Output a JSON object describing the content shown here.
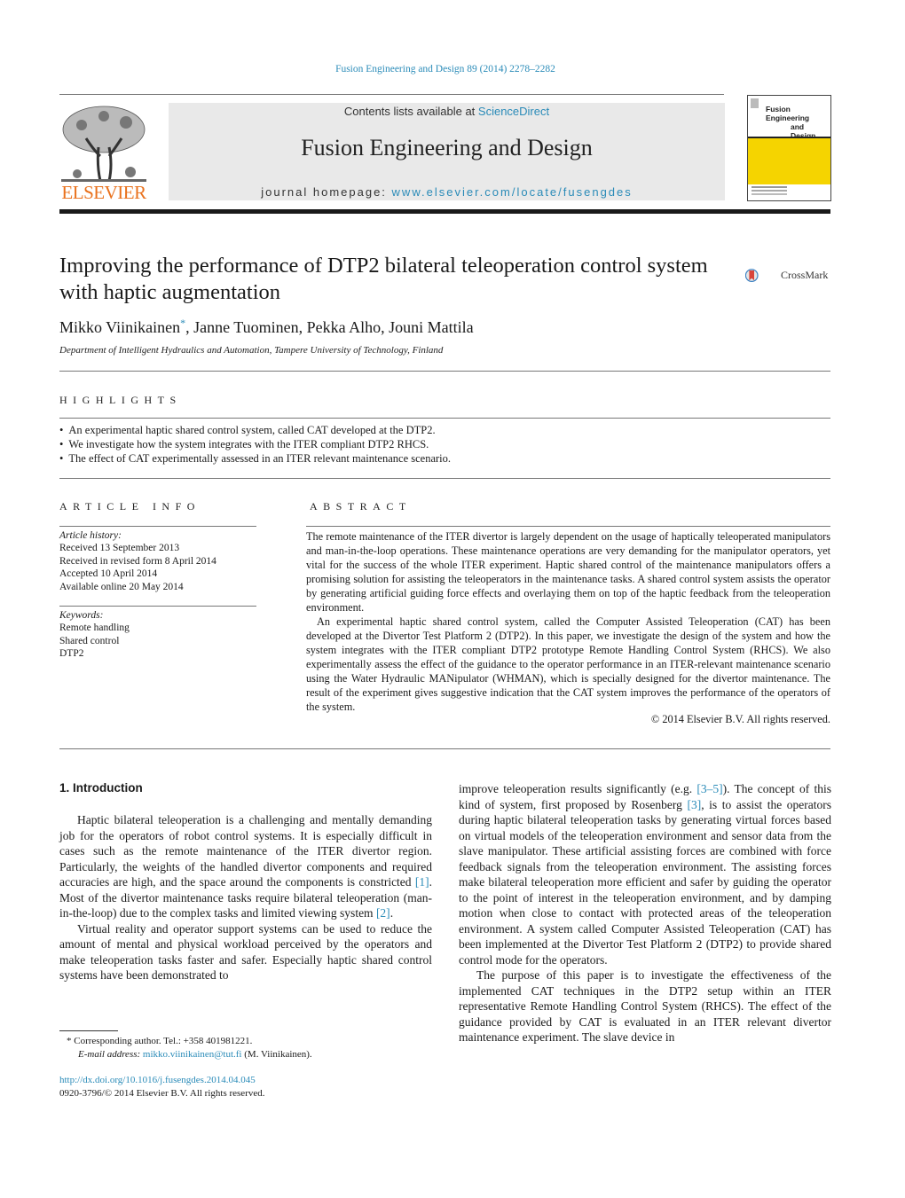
{
  "header": {
    "journal_reference": "Fusion Engineering and Design 89 (2014) 2278–2282",
    "publisher_logo_text": "ELSEVIER",
    "contents_prefix": "Contents lists available at ",
    "contents_link": "ScienceDirect",
    "journal_name": "Fusion Engineering and Design",
    "homepage_prefix": "journal homepage: ",
    "homepage_link": "www.elsevier.com/locate/fusengdes",
    "cover_title_line1": "Fusion Engineering",
    "cover_title_line2": "and Design",
    "cover_yellow": "#f5d400",
    "brand_orange": "#e9711c",
    "link_color": "#2a8bb8"
  },
  "article": {
    "title": "Improving the performance of DTP2 bilateral teleoperation control system with haptic augmentation",
    "crossmark_label": "CrossMark",
    "authors": [
      {
        "name": "Mikko Viinikainen",
        "mark": "*"
      },
      {
        "name": "Janne Tuominen"
      },
      {
        "name": "Pekka Alho"
      },
      {
        "name": "Jouni Mattila"
      }
    ],
    "author_separator": ", ",
    "affiliation": "Department of Intelligent Hydraulics and Automation, Tampere University of Technology, Finland"
  },
  "highlights": {
    "heading": "HIGHLIGHTS",
    "items": [
      "An experimental haptic shared control system, called CAT developed at the DTP2.",
      "We investigate how the system integrates with the ITER compliant DTP2 RHCS.",
      "The effect of CAT experimentally assessed in an ITER relevant maintenance scenario."
    ]
  },
  "article_info": {
    "heading": "ARTICLE INFO",
    "history_label": "Article history:",
    "history": [
      "Received 13 September 2013",
      "Received in revised form 8 April 2014",
      "Accepted 10 April 2014",
      "Available online 20 May 2014"
    ],
    "keywords_label": "Keywords:",
    "keywords": [
      "Remote handling",
      "Shared control",
      "DTP2"
    ]
  },
  "abstract": {
    "heading": "ABSTRACT",
    "paragraphs": [
      "The remote maintenance of the ITER divertor is largely dependent on the usage of haptically teleoperated manipulators and man-in-the-loop operations. These maintenance operations are very demanding for the manipulator operators, yet vital for the success of the whole ITER experiment. Haptic shared control of the maintenance manipulators offers a promising solution for assisting the teleoperators in the maintenance tasks. A shared control system assists the operator by generating artificial guiding force effects and overlaying them on top of the haptic feedback from the teleoperation environment.",
      "An experimental haptic shared control system, called the Computer Assisted Teleoperation (CAT) has been developed at the Divertor Test Platform 2 (DTP2). In this paper, we investigate the design of the system and how the system integrates with the ITER compliant DTP2 prototype Remote Handling Control System (RHCS). We also experimentally assess the effect of the guidance to the operator performance in an ITER-relevant maintenance scenario using the Water Hydraulic MANipulator (WHMAN), which is specially designed for the divertor maintenance. The result of the experiment gives suggestive indication that the CAT system improves the performance of the operators of the system."
    ],
    "copyright": "© 2014  Elsevier B.V. All rights reserved."
  },
  "body": {
    "section_heading": "1.  Introduction",
    "left": {
      "p1_a": "Haptic bilateral teleoperation is a challenging and mentally demanding job for the operators of robot control systems. It is especially difficult in cases such as the remote maintenance of the ITER divertor region. Particularly, the weights of the handled divertor components and required accuracies are high, and the space around the components is constricted ",
      "p1_ref1": "[1]",
      "p1_b": ". Most of the divertor maintenance tasks require bilateral teleoperation (man-in-the-loop) due to the complex tasks and limited viewing system ",
      "p1_ref2": "[2]",
      "p1_c": ".",
      "p2": "Virtual reality and operator support systems can be used to reduce the amount of mental and physical workload perceived by the operators and make teleoperation tasks faster and safer. Especially haptic shared control systems have been demonstrated to"
    },
    "right": {
      "p1_a": "improve teleoperation results significantly (e.g. ",
      "p1_ref1": "[3–5]",
      "p1_b": "). The concept of this kind of system, first proposed by Rosenberg ",
      "p1_ref2": "[3]",
      "p1_c": ", is to assist the operators during haptic bilateral teleoperation tasks by generating virtual forces based on virtual models of the teleoperation environment and sensor data from the slave manipulator. These artificial assisting forces are combined with force feedback signals from the teleoperation environment. The assisting forces make bilateral teleoperation more efficient and safer by guiding the operator to the point of interest in the teleoperation environment, and by damping motion when close to contact with protected areas of the teleoperation environment. A system called Computer Assisted Teleoperation (CAT) has been implemented at the Divertor Test Platform 2 (DTP2) to provide shared control mode for the operators.",
      "p2": "The purpose of this paper is to investigate the effectiveness of the implemented CAT techniques in the DTP2 setup within an ITER representative Remote Handling Control System (RHCS). The effect of the guidance provided by CAT is evaluated in an ITER relevant divertor maintenance experiment. The slave device in"
    }
  },
  "footnote": {
    "mark": "*",
    "text": " Corresponding author. Tel.: +358 401981221.",
    "email_label": "E-mail address: ",
    "email": "mikko.viinikainen@tut.fi",
    "email_suffix": " (M. Viinikainen)."
  },
  "doi": {
    "link": "http://dx.doi.org/10.1016/j.fusengdes.2014.04.045",
    "rights": "0920-3796/© 2014 Elsevier B.V. All rights reserved."
  }
}
